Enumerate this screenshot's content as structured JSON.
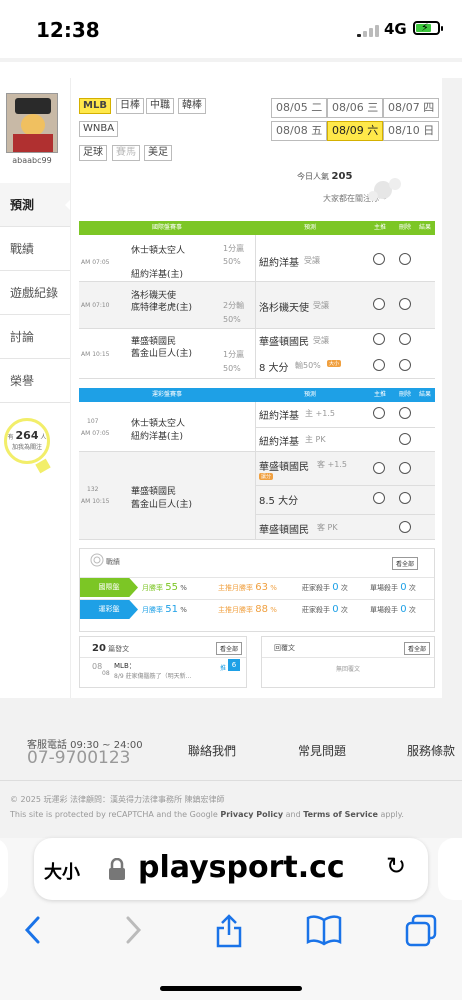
{
  "status_bar": {
    "time": "12:38",
    "network": "4G"
  },
  "sidebar": {
    "username": "abaabc99",
    "items": [
      {
        "label": "預測",
        "active": true
      },
      {
        "label": "戰績"
      },
      {
        "label": "遊戲紀錄"
      },
      {
        "label": "討論"
      },
      {
        "label": "榮譽"
      }
    ],
    "bulb": {
      "prefix": "有",
      "count": "264",
      "unit": "人",
      "text": "加我為關注"
    }
  },
  "leagues": [
    {
      "label": "MLB",
      "selected": true
    },
    {
      "label": "日棒"
    },
    {
      "label": "中職"
    },
    {
      "label": "韓棒"
    },
    {
      "label": "WNBA"
    },
    {
      "label": "足球"
    },
    {
      "label": "賽馬",
      "disabled": true
    },
    {
      "label": "美足"
    }
  ],
  "dates": [
    {
      "label": "08/05 二"
    },
    {
      "label": "08/06 三"
    },
    {
      "label": "08/07 四"
    },
    {
      "label": "08/08 五"
    },
    {
      "label": "08/09 六",
      "selected": true
    },
    {
      "label": "08/10 日"
    }
  ],
  "popularity": {
    "label": "今日人氣",
    "count": "205",
    "note": "大家都在關注你～"
  },
  "intl_table": {
    "header": {
      "game": "國際盤賽事",
      "predict": "預測",
      "main": "主推",
      "del": "刪除",
      "result": "結果"
    },
    "color": "#7cc625",
    "games": [
      {
        "time": "AM 07:05",
        "away": "休士頓太空人",
        "home": "紐約洋基(主)",
        "line": "1分贏",
        "pct": "50%",
        "pick": "紐約洋基",
        "pick_tag": "受讓"
      },
      {
        "time": "AM 07:10",
        "away": "洛杉磯天使",
        "home": "底特律老虎(主)",
        "line": "2分輸",
        "pct": "50%",
        "pick": "洛杉磯天使",
        "pick_tag": "受讓"
      },
      {
        "time": "AM 10:15",
        "away": "華盛頓國民",
        "home": "舊金山巨人(主)",
        "line": "1分贏",
        "pct": "50%",
        "pick": "華盛頓國民",
        "pick_tag": "受讓",
        "pick2": "8 大分",
        "pick2_tag": "輸50%",
        "badge": "大小"
      }
    ]
  },
  "lottery_table": {
    "header": {
      "game": "運彩盤賽事",
      "predict": "預測",
      "main": "主推",
      "del": "刪除",
      "result": "結果"
    },
    "color": "#1ea0e6",
    "games": [
      {
        "no": "107",
        "time": "AM 07:05",
        "away": "休士頓太空人",
        "home": "紐約洋基(主)",
        "picks": [
          {
            "team": "紐約洋基",
            "tag": "主 +1.5"
          },
          {
            "team": "紐約洋基",
            "tag": "主 PK"
          }
        ]
      },
      {
        "no": "132",
        "time": "AM 10:15",
        "away": "華盛頓國民",
        "home": "舊金山巨人(主)",
        "picks": [
          {
            "team": "華盛頓國民",
            "tag": "客 +1.5",
            "badge": "讓分"
          },
          {
            "team": "8.5 大分",
            "tag": ""
          },
          {
            "team": "華盛頓國民",
            "tag": "客 PK"
          }
        ]
      }
    ]
  },
  "stats": {
    "title": "戰績",
    "see_all": "看全部",
    "rows": [
      {
        "label": "國際盤",
        "color": "#7cc625",
        "month_rate_label": "月勝率",
        "month_rate": "55",
        "main_rate_label": "主推月勝率",
        "main_rate": "63",
        "streak_label": "莊家殺手",
        "streak": "0",
        "single_label": "單場殺手",
        "single": "0",
        "unit_pct": "%",
        "unit_times": "次"
      },
      {
        "label": "運彩盤",
        "color": "#1ea0e6",
        "month_rate_label": "月勝率",
        "month_rate": "51",
        "main_rate_label": "主推月勝率",
        "main_rate": "88",
        "streak_label": "莊家殺手",
        "streak": "0",
        "single_label": "單場殺手",
        "single": "0",
        "unit_pct": "%",
        "unit_times": "次"
      }
    ]
  },
  "posts": {
    "count": "20",
    "label": "篇發文",
    "see_all": "看全部",
    "item": {
      "day": "08",
      "month": "08",
      "league": "MLB：",
      "title": "8/9 莊家傷腦筋了（明天新...",
      "push_label": "推",
      "push": "6"
    }
  },
  "replies": {
    "label": "回覆文",
    "see_all": "看全部",
    "empty": "無回覆文"
  },
  "footer": {
    "hotline_label": "客服電話 09:30 ~ 24:00",
    "phone": "07-9700123",
    "links": [
      "聯絡我們",
      "常見問題",
      "服務條款"
    ],
    "copyright": "© 2025 玩運彩 法律顧問：漢英得力法律事務所 陳鎮宏律師",
    "recaptcha_pre": "This site is protected by reCAPTCHA and the Google ",
    "privacy": "Privacy Policy",
    "and": " and ",
    "terms": "Terms of Service",
    "apply": " apply."
  },
  "safari": {
    "text_size": "大小",
    "url": "playsport.cc"
  }
}
